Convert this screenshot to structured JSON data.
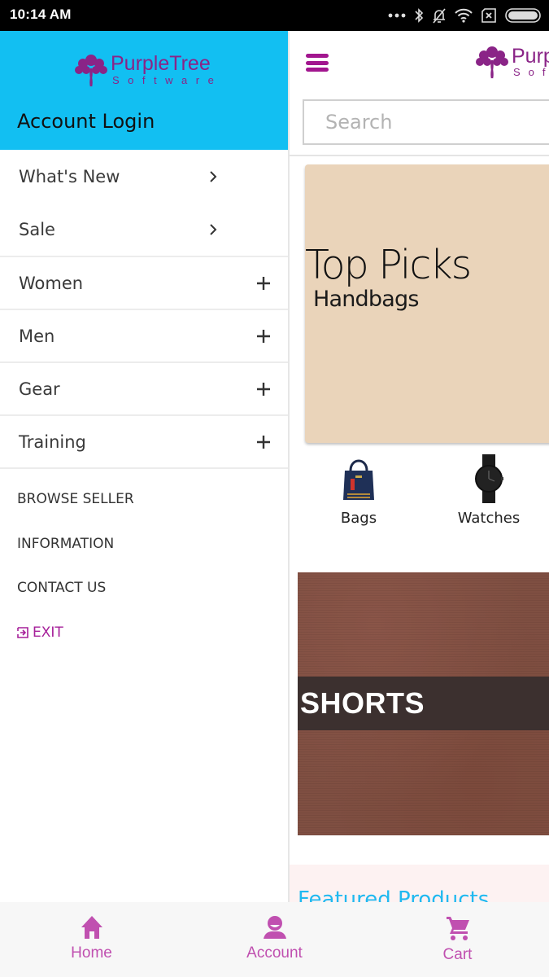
{
  "status_bar": {
    "time": "10:14 AM",
    "icons": [
      "more-dots-icon",
      "bluetooth-icon",
      "bell-off-icon",
      "wifi-icon",
      "sim-x-icon",
      "battery-icon"
    ]
  },
  "brand": {
    "name_line1": "PurpleTree",
    "name_line2": "Software",
    "color": "#8a2487"
  },
  "drawer": {
    "header_bg": "#12bff2",
    "account_login": "Account Login",
    "menu": [
      {
        "label": "What's New",
        "icon": "chevron-right-icon"
      },
      {
        "label": "Sale",
        "icon": "chevron-right-icon"
      },
      {
        "label": "Women",
        "icon": "plus-icon"
      },
      {
        "label": "Men",
        "icon": "plus-icon"
      },
      {
        "label": "Gear",
        "icon": "plus-icon"
      },
      {
        "label": "Training",
        "icon": "plus-icon"
      }
    ],
    "links": [
      {
        "label": "BROWSE SELLER"
      },
      {
        "label": "INFORMATION"
      },
      {
        "label": "CONTACT US"
      },
      {
        "label": "EXIT",
        "icon": "exit-icon"
      }
    ]
  },
  "main": {
    "menu_icon": "hamburger-icon",
    "search": {
      "placeholder": "Search",
      "value": ""
    },
    "banner_top": {
      "title": "Top Picks",
      "subtitle": "Handbags"
    },
    "categories": [
      {
        "label": "Bags",
        "icon": "handbag-image"
      },
      {
        "label": "Watches",
        "icon": "watch-image"
      }
    ],
    "banner_shorts": {
      "title": "SHORTS"
    },
    "featured_heading": "Featured Products"
  },
  "bottom_nav": {
    "accent": "#c050b0",
    "tabs": [
      {
        "label": "Home",
        "icon": "home-icon"
      },
      {
        "label": "Account",
        "icon": "account-icon"
      },
      {
        "label": "Cart",
        "icon": "cart-icon"
      }
    ]
  }
}
